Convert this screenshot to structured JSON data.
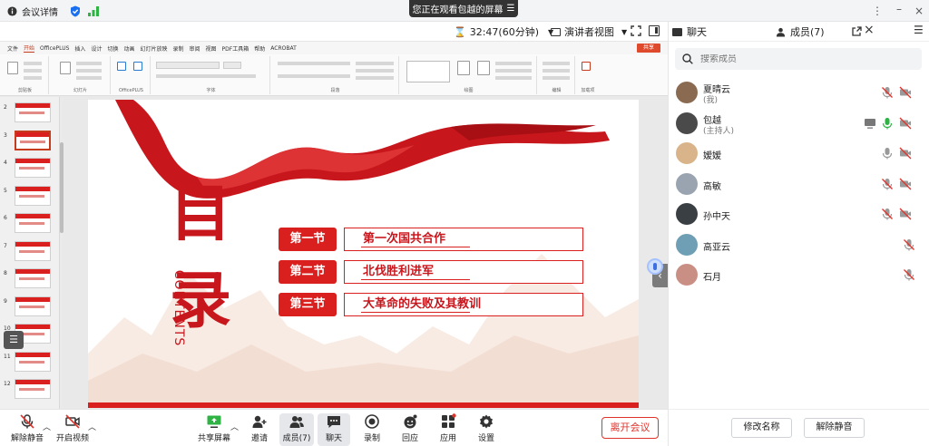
{
  "titlebar": {
    "meeting_details": "会议详情",
    "screen_banner": "您正在观看包越的屏幕"
  },
  "topbar": {
    "timer": "32:47(60分钟)",
    "presenter_view": "演讲者视图"
  },
  "ppt": {
    "menu": [
      "文件",
      "开始",
      "OfficePLUS",
      "插入",
      "设计",
      "切换",
      "动画",
      "幻灯片放映",
      "录制",
      "审阅",
      "视图",
      "PDF工具箱",
      "帮助",
      "ACROBAT"
    ],
    "active_menu": "开始",
    "share": "共享",
    "ribbon_groups": [
      "剪贴板",
      "幻灯片",
      "OfficePLUS",
      "字体",
      "段落",
      "绘图",
      "编辑",
      "加载项"
    ],
    "thumb_numbers": [
      "2",
      "3",
      "4",
      "5",
      "6",
      "7",
      "8",
      "9",
      "10",
      "11",
      "12"
    ],
    "selected_thumb": "3"
  },
  "slide": {
    "big_char_1": "目",
    "big_char_2": "录",
    "contents": "CONTENTS",
    "sections": [
      {
        "label": "第一节",
        "title": "第一次国共合作"
      },
      {
        "label": "第二节",
        "title": "北伐胜利进军"
      },
      {
        "label": "第三节",
        "title": "大革命的失败及其教训"
      }
    ]
  },
  "toolbar": {
    "mute": "解除静音",
    "video": "开启视频",
    "share": "共享屏幕",
    "invite": "邀请",
    "members": "成员(7)",
    "chat": "聊天",
    "record": "录制",
    "reply": "回应",
    "apps": "应用",
    "settings": "设置",
    "leave": "离开会议"
  },
  "panel": {
    "tab_chat": "聊天",
    "tab_members": "成员(7)",
    "search_placeholder": "搜索成员",
    "members": [
      {
        "name": "夏晴云",
        "role": "(我)",
        "avatar_color": "#8a6a50"
      },
      {
        "name": "包越",
        "role": "(主持人)",
        "avatar_color": "#4a4a4a"
      },
      {
        "name": "嫒嫒",
        "role": "",
        "avatar_color": "#d9b48a"
      },
      {
        "name": "高敏",
        "role": "",
        "avatar_color": "#9aa4b0"
      },
      {
        "name": "孙中天",
        "role": "",
        "avatar_color": "#3a3f44"
      },
      {
        "name": "高亚云",
        "role": "",
        "avatar_color": "#6f9fb5"
      },
      {
        "name": "石月",
        "role": "",
        "avatar_color": "#c98f84"
      }
    ],
    "rename": "修改名称",
    "unmute": "解除静音"
  },
  "colors": {
    "accent_red": "#d9201f",
    "leave_red": "#e0332b",
    "mic_green": "#2fb344"
  }
}
